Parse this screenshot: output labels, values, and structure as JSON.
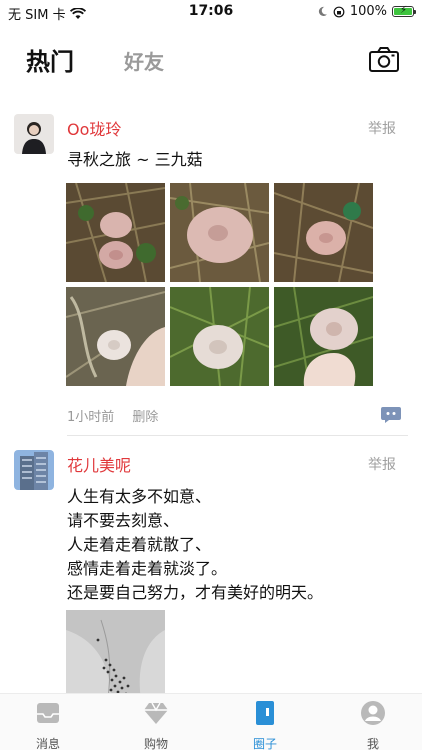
{
  "status_bar": {
    "carrier": "无 SIM 卡",
    "time": "17:06",
    "battery": "100%",
    "battery_level": 1.0
  },
  "header": {
    "tab_hot": "热门",
    "tab_friends": "好友",
    "camera_icon": "camera-icon"
  },
  "posts": [
    {
      "username": "Oo珑玲",
      "report": "举报",
      "text": "寻秋之旅 ~ 三九菇",
      "time": "1小时前",
      "delete": "删除",
      "photo_count": 6
    },
    {
      "username": "花儿美呢",
      "report": "举报",
      "lines": [
        "人生有太多不如意、",
        "请不要去刻意、",
        "人走着走着就散了、",
        "感情走着走着就淡了。",
        "还是要自己努力，才有美好的明天。"
      ]
    }
  ],
  "tabbar": {
    "items": [
      {
        "label": "消息",
        "icon": "message-icon"
      },
      {
        "label": "购物",
        "icon": "shopping-icon"
      },
      {
        "label": "圈子",
        "icon": "circle-icon"
      },
      {
        "label": "我",
        "icon": "profile-icon"
      }
    ],
    "active": "圈子"
  },
  "colors": {
    "username": "#e0383b",
    "active_tab": "#2a8fd6",
    "muted": "#999999"
  }
}
